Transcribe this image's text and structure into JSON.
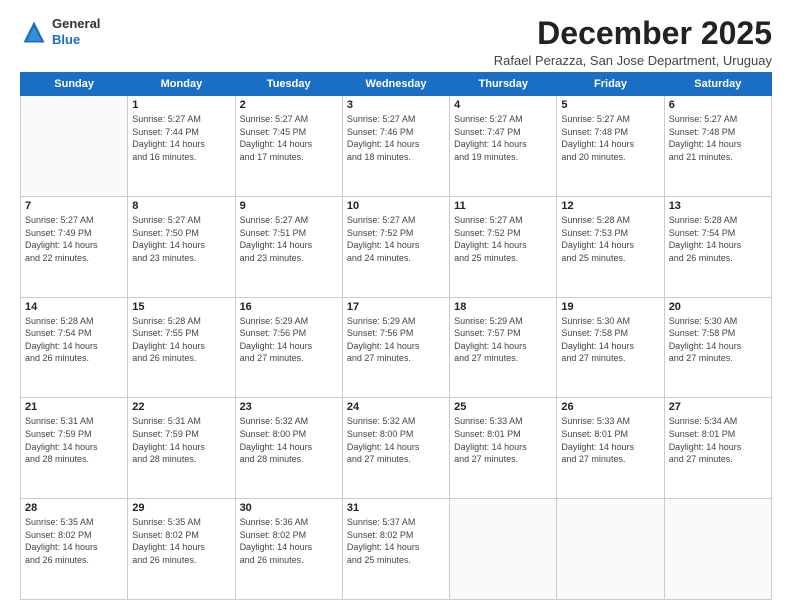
{
  "logo": {
    "general": "General",
    "blue": "Blue"
  },
  "header": {
    "month_title": "December 2025",
    "subtitle": "Rafael Perazza, San Jose Department, Uruguay"
  },
  "days_of_week": [
    "Sunday",
    "Monday",
    "Tuesday",
    "Wednesday",
    "Thursday",
    "Friday",
    "Saturday"
  ],
  "weeks": [
    [
      {
        "day": "",
        "info": ""
      },
      {
        "day": "1",
        "info": "Sunrise: 5:27 AM\nSunset: 7:44 PM\nDaylight: 14 hours\nand 16 minutes."
      },
      {
        "day": "2",
        "info": "Sunrise: 5:27 AM\nSunset: 7:45 PM\nDaylight: 14 hours\nand 17 minutes."
      },
      {
        "day": "3",
        "info": "Sunrise: 5:27 AM\nSunset: 7:46 PM\nDaylight: 14 hours\nand 18 minutes."
      },
      {
        "day": "4",
        "info": "Sunrise: 5:27 AM\nSunset: 7:47 PM\nDaylight: 14 hours\nand 19 minutes."
      },
      {
        "day": "5",
        "info": "Sunrise: 5:27 AM\nSunset: 7:48 PM\nDaylight: 14 hours\nand 20 minutes."
      },
      {
        "day": "6",
        "info": "Sunrise: 5:27 AM\nSunset: 7:48 PM\nDaylight: 14 hours\nand 21 minutes."
      }
    ],
    [
      {
        "day": "7",
        "info": "Sunrise: 5:27 AM\nSunset: 7:49 PM\nDaylight: 14 hours\nand 22 minutes."
      },
      {
        "day": "8",
        "info": "Sunrise: 5:27 AM\nSunset: 7:50 PM\nDaylight: 14 hours\nand 23 minutes."
      },
      {
        "day": "9",
        "info": "Sunrise: 5:27 AM\nSunset: 7:51 PM\nDaylight: 14 hours\nand 23 minutes."
      },
      {
        "day": "10",
        "info": "Sunrise: 5:27 AM\nSunset: 7:52 PM\nDaylight: 14 hours\nand 24 minutes."
      },
      {
        "day": "11",
        "info": "Sunrise: 5:27 AM\nSunset: 7:52 PM\nDaylight: 14 hours\nand 25 minutes."
      },
      {
        "day": "12",
        "info": "Sunrise: 5:28 AM\nSunset: 7:53 PM\nDaylight: 14 hours\nand 25 minutes."
      },
      {
        "day": "13",
        "info": "Sunrise: 5:28 AM\nSunset: 7:54 PM\nDaylight: 14 hours\nand 26 minutes."
      }
    ],
    [
      {
        "day": "14",
        "info": "Sunrise: 5:28 AM\nSunset: 7:54 PM\nDaylight: 14 hours\nand 26 minutes."
      },
      {
        "day": "15",
        "info": "Sunrise: 5:28 AM\nSunset: 7:55 PM\nDaylight: 14 hours\nand 26 minutes."
      },
      {
        "day": "16",
        "info": "Sunrise: 5:29 AM\nSunset: 7:56 PM\nDaylight: 14 hours\nand 27 minutes."
      },
      {
        "day": "17",
        "info": "Sunrise: 5:29 AM\nSunset: 7:56 PM\nDaylight: 14 hours\nand 27 minutes."
      },
      {
        "day": "18",
        "info": "Sunrise: 5:29 AM\nSunset: 7:57 PM\nDaylight: 14 hours\nand 27 minutes."
      },
      {
        "day": "19",
        "info": "Sunrise: 5:30 AM\nSunset: 7:58 PM\nDaylight: 14 hours\nand 27 minutes."
      },
      {
        "day": "20",
        "info": "Sunrise: 5:30 AM\nSunset: 7:58 PM\nDaylight: 14 hours\nand 27 minutes."
      }
    ],
    [
      {
        "day": "21",
        "info": "Sunrise: 5:31 AM\nSunset: 7:59 PM\nDaylight: 14 hours\nand 28 minutes."
      },
      {
        "day": "22",
        "info": "Sunrise: 5:31 AM\nSunset: 7:59 PM\nDaylight: 14 hours\nand 28 minutes."
      },
      {
        "day": "23",
        "info": "Sunrise: 5:32 AM\nSunset: 8:00 PM\nDaylight: 14 hours\nand 28 minutes."
      },
      {
        "day": "24",
        "info": "Sunrise: 5:32 AM\nSunset: 8:00 PM\nDaylight: 14 hours\nand 27 minutes."
      },
      {
        "day": "25",
        "info": "Sunrise: 5:33 AM\nSunset: 8:01 PM\nDaylight: 14 hours\nand 27 minutes."
      },
      {
        "day": "26",
        "info": "Sunrise: 5:33 AM\nSunset: 8:01 PM\nDaylight: 14 hours\nand 27 minutes."
      },
      {
        "day": "27",
        "info": "Sunrise: 5:34 AM\nSunset: 8:01 PM\nDaylight: 14 hours\nand 27 minutes."
      }
    ],
    [
      {
        "day": "28",
        "info": "Sunrise: 5:35 AM\nSunset: 8:02 PM\nDaylight: 14 hours\nand 26 minutes."
      },
      {
        "day": "29",
        "info": "Sunrise: 5:35 AM\nSunset: 8:02 PM\nDaylight: 14 hours\nand 26 minutes."
      },
      {
        "day": "30",
        "info": "Sunrise: 5:36 AM\nSunset: 8:02 PM\nDaylight: 14 hours\nand 26 minutes."
      },
      {
        "day": "31",
        "info": "Sunrise: 5:37 AM\nSunset: 8:02 PM\nDaylight: 14 hours\nand 25 minutes."
      },
      {
        "day": "",
        "info": ""
      },
      {
        "day": "",
        "info": ""
      },
      {
        "day": "",
        "info": ""
      }
    ]
  ]
}
